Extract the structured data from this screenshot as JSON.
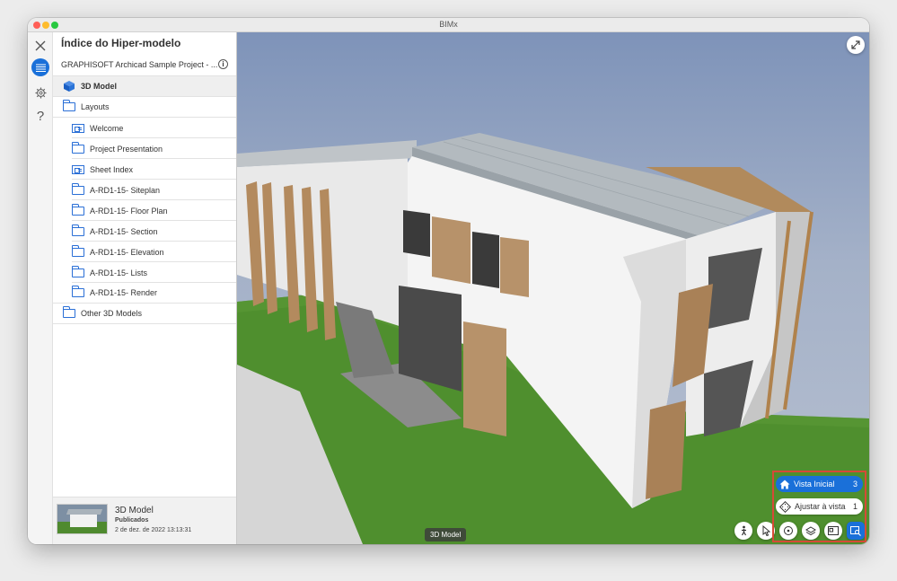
{
  "window": {
    "title": "BIMx"
  },
  "rail": {
    "close_icon": "close-icon",
    "index_icon": "list-icon",
    "settings_icon": "gear-icon",
    "help_label": "?"
  },
  "sidebar": {
    "header": "Índice do Hiper-modelo",
    "project_name": "GRAPHISOFT Archicad Sample Project - ...",
    "tree": {
      "model": "3D Model",
      "layouts": "Layouts",
      "layout_items": [
        "Welcome",
        "Project Presentation",
        "Sheet Index",
        "A-RD1-15- Siteplan",
        "A-RD1-15- Floor Plan",
        "A-RD1-15- Section",
        "A-RD1-15- Elevation",
        "A-RD1-15- Lists",
        "A-RD1-15- Render"
      ],
      "other": "Other 3D Models"
    },
    "footer": {
      "title": "3D Model",
      "status": "Publicados",
      "date": "2 de dez. de 2022 13:13:31"
    }
  },
  "viewport": {
    "view_label": "3D Model",
    "home_view": {
      "label": "Vista Inicial",
      "count": "3"
    },
    "fit_view": {
      "label": "Ajustar à vista",
      "count": "1"
    },
    "colors": {
      "accent": "#1a70d9",
      "highlight": "#d64a36"
    }
  }
}
